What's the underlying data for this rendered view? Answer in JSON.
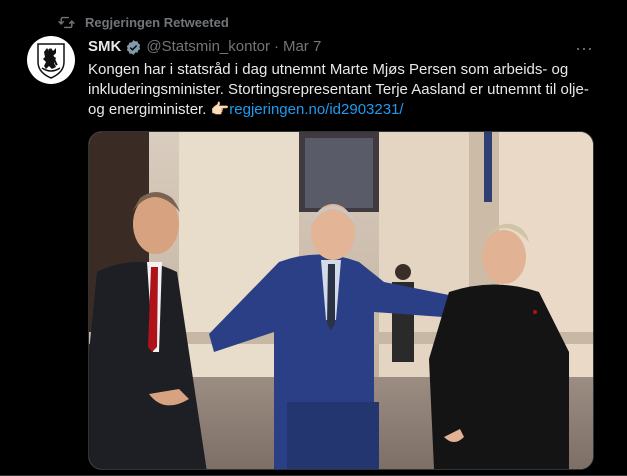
{
  "retweet": {
    "label": "Regjeringen Retweeted",
    "icon": "retweet-icon"
  },
  "author": {
    "name": "SMK",
    "handle": "@Statsmin_kontor",
    "separator": "·",
    "date": "Mar 7",
    "verified_icon": "verified-badge-icon",
    "avatar_icon": "norwegian-lion-coat-of-arms"
  },
  "tweet": {
    "text_part1": "Kongen har i statsråd i dag utnemnt Marte Mjøs Persen som arbeids- og inkluderingsminister. Stortingsrepresentant Terje Aasland er utnemnt til olje- og energiminister. ",
    "emoji": "👉🏻",
    "link_text": "regjeringen.no/id2903231/"
  },
  "more_label": "···",
  "colors": {
    "background": "#000000",
    "text": "#e7e9ea",
    "muted": "#71767b",
    "link": "#1d9bf0",
    "verified": "#829aab"
  }
}
